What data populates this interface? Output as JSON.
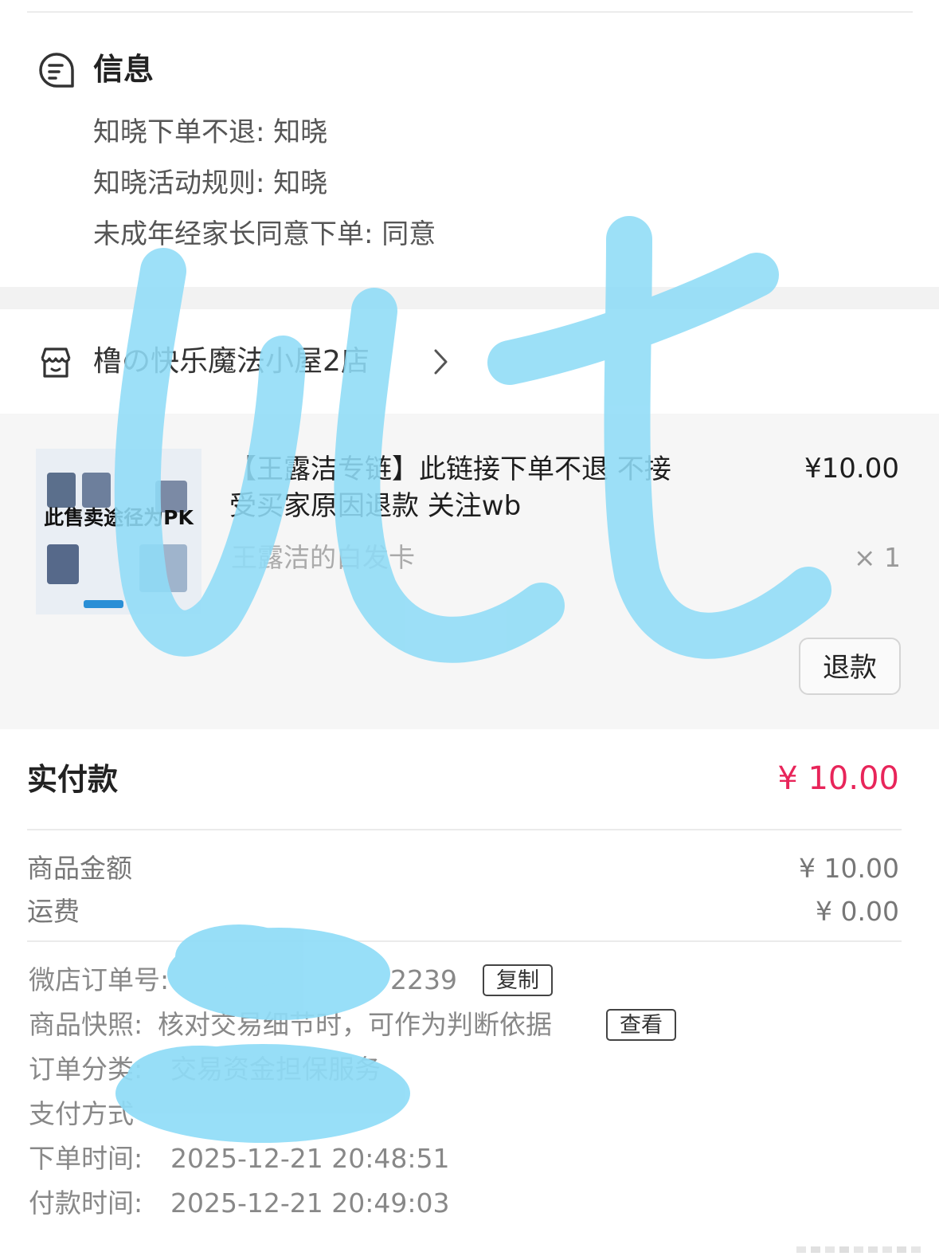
{
  "info": {
    "title": "信息",
    "lines": [
      "知晓下单不退: 知晓",
      "知晓活动规则: 知晓",
      "未成年经家长同意下单: 同意"
    ]
  },
  "shop": {
    "name": "橹の快乐魔法小屋2店"
  },
  "product": {
    "thumbnail_text": "此售卖途径为PK",
    "title": "【王露洁专链】此链接下单不退 不接受买家原因退款 关注wb",
    "price": "¥10.00",
    "sku": "王露洁的白发卡",
    "quantity": "× 1",
    "refund_label": "退款"
  },
  "payment": {
    "paid_label": "实付款",
    "paid_value": "¥ 10.00",
    "accent_color": "#e8255a",
    "goods_label": "商品金额",
    "goods_value": "¥ 10.00",
    "shipping_label": "运费",
    "shipping_value": "¥ 0.00"
  },
  "details": {
    "order_no_label": "微店订单号:",
    "order_no_value": "2239",
    "copy_label": "复制",
    "snapshot_label": "商品快照:",
    "snapshot_value": "核对交易细节时，可作为判断依据",
    "view_label": "查看",
    "category_label": "订单分类:",
    "category_value": "交易资金担保服务",
    "pay_method_label": "支付方式",
    "order_time_label": "下单时间:",
    "order_time_value": "2025-12-21 20:48:51",
    "pay_time_label": "付款时间:",
    "pay_time_value": "2025-12-21 20:49:03"
  },
  "overlay_color": "#8fdcf7"
}
